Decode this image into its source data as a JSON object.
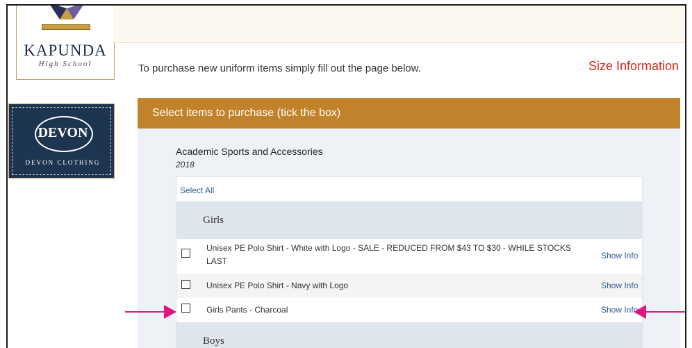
{
  "school": {
    "name": "KAPUNDA",
    "subtitle": "High School"
  },
  "supplier": {
    "logo_text": "DEVON",
    "name": "DEVON CLOTHING"
  },
  "intro_text": "To purchase new uniform items simply fill out the page below.",
  "size_info_link": "Size Information",
  "purchase_header": "Select items to purchase (tick the box)",
  "category": {
    "title": "Academic Sports and Accessories",
    "year": "2018"
  },
  "select_all_label": "Select All",
  "groups": [
    {
      "name": "Girls"
    },
    {
      "name": "Boys"
    }
  ],
  "items": [
    {
      "label": "Unisex PE Polo Shirt - White with Logo - SALE - REDUCED FROM $43 TO $30 - WHILE STOCKS LAST",
      "checked": false,
      "info_label": "Show Info"
    },
    {
      "label": "Unisex PE Polo Shirt - Navy with Logo",
      "checked": false,
      "info_label": "Show Info"
    },
    {
      "label": "Girls Pants - Charcoal",
      "checked": false,
      "info_label": "Show Info"
    }
  ],
  "colors": {
    "accent": "#c2822b",
    "link": "#2e5d9a",
    "size_info": "#d6281a",
    "annotation_arrow": "#e0157f"
  }
}
